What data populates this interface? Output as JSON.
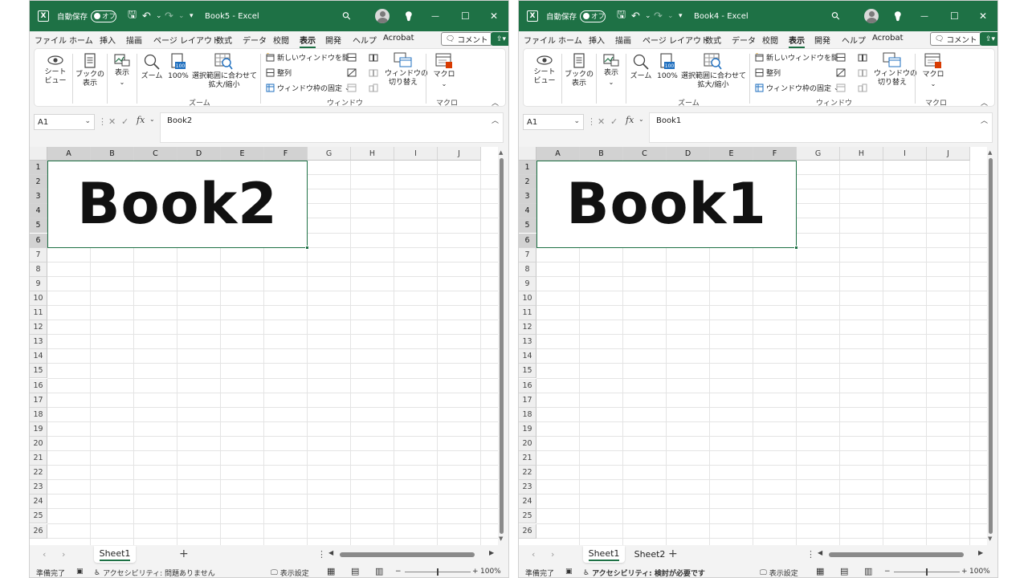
{
  "windows": [
    {
      "title": "Book5  -  Excel",
      "autosave_label": "自動保存",
      "autosave_state": "オフ",
      "name_box": "A1",
      "formula": "Book2",
      "big_text": "Book2",
      "sheets": [
        "Sheet1"
      ],
      "status_ready": "準備完了",
      "accessibility": "アクセシビリティ: 問題ありません",
      "view_settings": "表示設定",
      "zoom": "100%"
    },
    {
      "title": "Book4  -  Excel",
      "autosave_label": "自動保存",
      "autosave_state": "オフ",
      "name_box": "A1",
      "formula": "Book1",
      "big_text": "Book1",
      "sheets": [
        "Sheet1",
        "Sheet2"
      ],
      "status_ready": "準備完了",
      "accessibility": "アクセシビリティ: 検討が必要です",
      "view_settings": "表示設定",
      "zoom": "100%"
    }
  ],
  "menu_tabs": [
    "ファイル",
    "ホーム",
    "挿入",
    "描画",
    "ページ レイアウト",
    "数式",
    "データ",
    "校閲",
    "表示",
    "開発",
    "ヘルプ",
    "Acrobat"
  ],
  "active_tab": "表示",
  "comment_label": "コメント",
  "ribbon": {
    "sheet_view": [
      "シート",
      "ビュー"
    ],
    "book_view": [
      "ブックの",
      "表示"
    ],
    "show": "表示",
    "zoom": "ズーム",
    "zoom100": "100%",
    "zoom_selection": [
      "選択範囲に合わせて",
      "拡大/縮小"
    ],
    "zoom_group": "ズーム",
    "new_window": "新しいウィンドウを開く",
    "arrange": "整列",
    "freeze": "ウィンドウ枠の固定",
    "switch_window": [
      "ウィンドウの",
      "切り替え"
    ],
    "window_group": "ウィンドウ",
    "macro": "マクロ",
    "macro_group": "マクロ"
  },
  "columns": [
    "A",
    "B",
    "C",
    "D",
    "E",
    "F",
    "G",
    "H",
    "I",
    "J"
  ],
  "rows": [
    "1",
    "2",
    "3",
    "4",
    "5",
    "6",
    "7",
    "8",
    "9",
    "10",
    "11",
    "12",
    "13",
    "14",
    "15",
    "16",
    "17",
    "18",
    "19",
    "20",
    "21",
    "22",
    "23",
    "24",
    "25",
    "26"
  ],
  "icons": [
    "excel-logo-icon",
    "save-icon",
    "undo-icon",
    "redo-icon",
    "search-icon",
    "lightbulb-icon",
    "minimize-icon",
    "maximize-icon",
    "close-icon"
  ],
  "colors": {
    "accent": "#1e7145",
    "grid": "#e4e4e4",
    "header": "#efefef"
  }
}
